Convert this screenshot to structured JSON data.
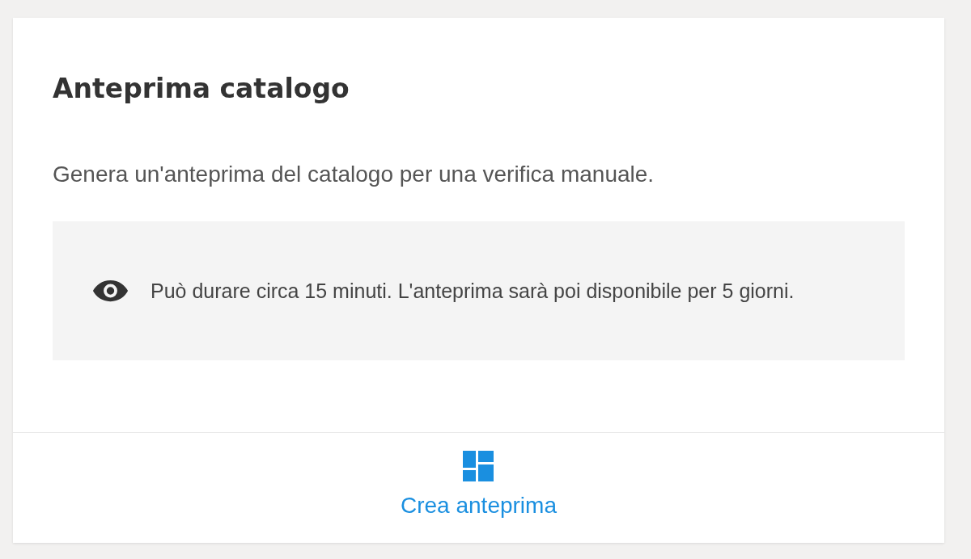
{
  "card": {
    "title": "Anteprima catalogo",
    "description": "Genera un'anteprima del catalogo per una verifica manuale.",
    "notice": {
      "text": "Può durare circa 15 minuti. L'anteprima sarà poi disponibile per 5 giorni."
    },
    "action": {
      "label": "Crea anteprima"
    }
  }
}
